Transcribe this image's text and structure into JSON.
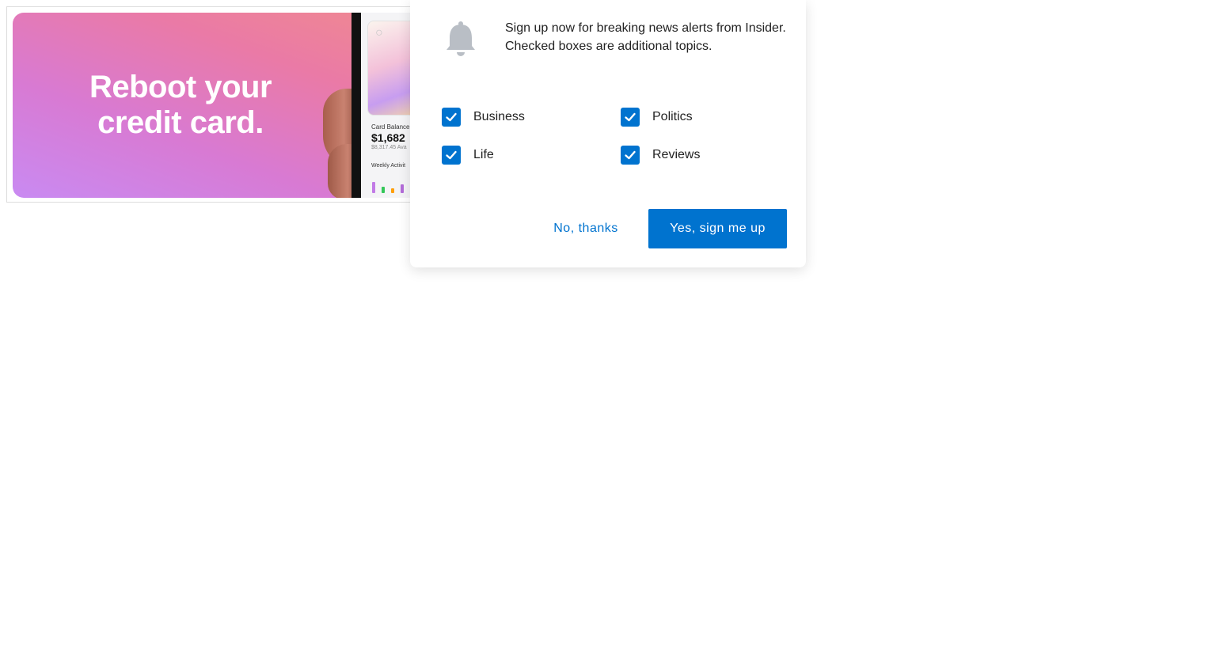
{
  "ad": {
    "headline_line1": "Reboot your",
    "headline_line2": "credit card.",
    "card_balance_label": "Card Balance",
    "card_balance_value": "$1,682",
    "card_available": "$8,317.45 Ava",
    "weekly_activity_label": "Weekly Activit",
    "bar_colors": [
      "#c27be6",
      "#34c759",
      "#ff9f0a",
      "#b36bd9"
    ],
    "bar_levels": [
      0.8,
      0.45,
      0.35,
      0.6
    ]
  },
  "popup": {
    "message_line1": "Sign up now for breaking news alerts from Insider.",
    "message_line2": "Checked boxes are additional topics.",
    "topics": [
      {
        "label": "Business",
        "checked": true
      },
      {
        "label": "Politics",
        "checked": true
      },
      {
        "label": "Life",
        "checked": true
      },
      {
        "label": "Reviews",
        "checked": true
      }
    ],
    "no_button": "No, thanks",
    "yes_button": "Yes, sign me up",
    "accent_color": "#0073cf"
  }
}
